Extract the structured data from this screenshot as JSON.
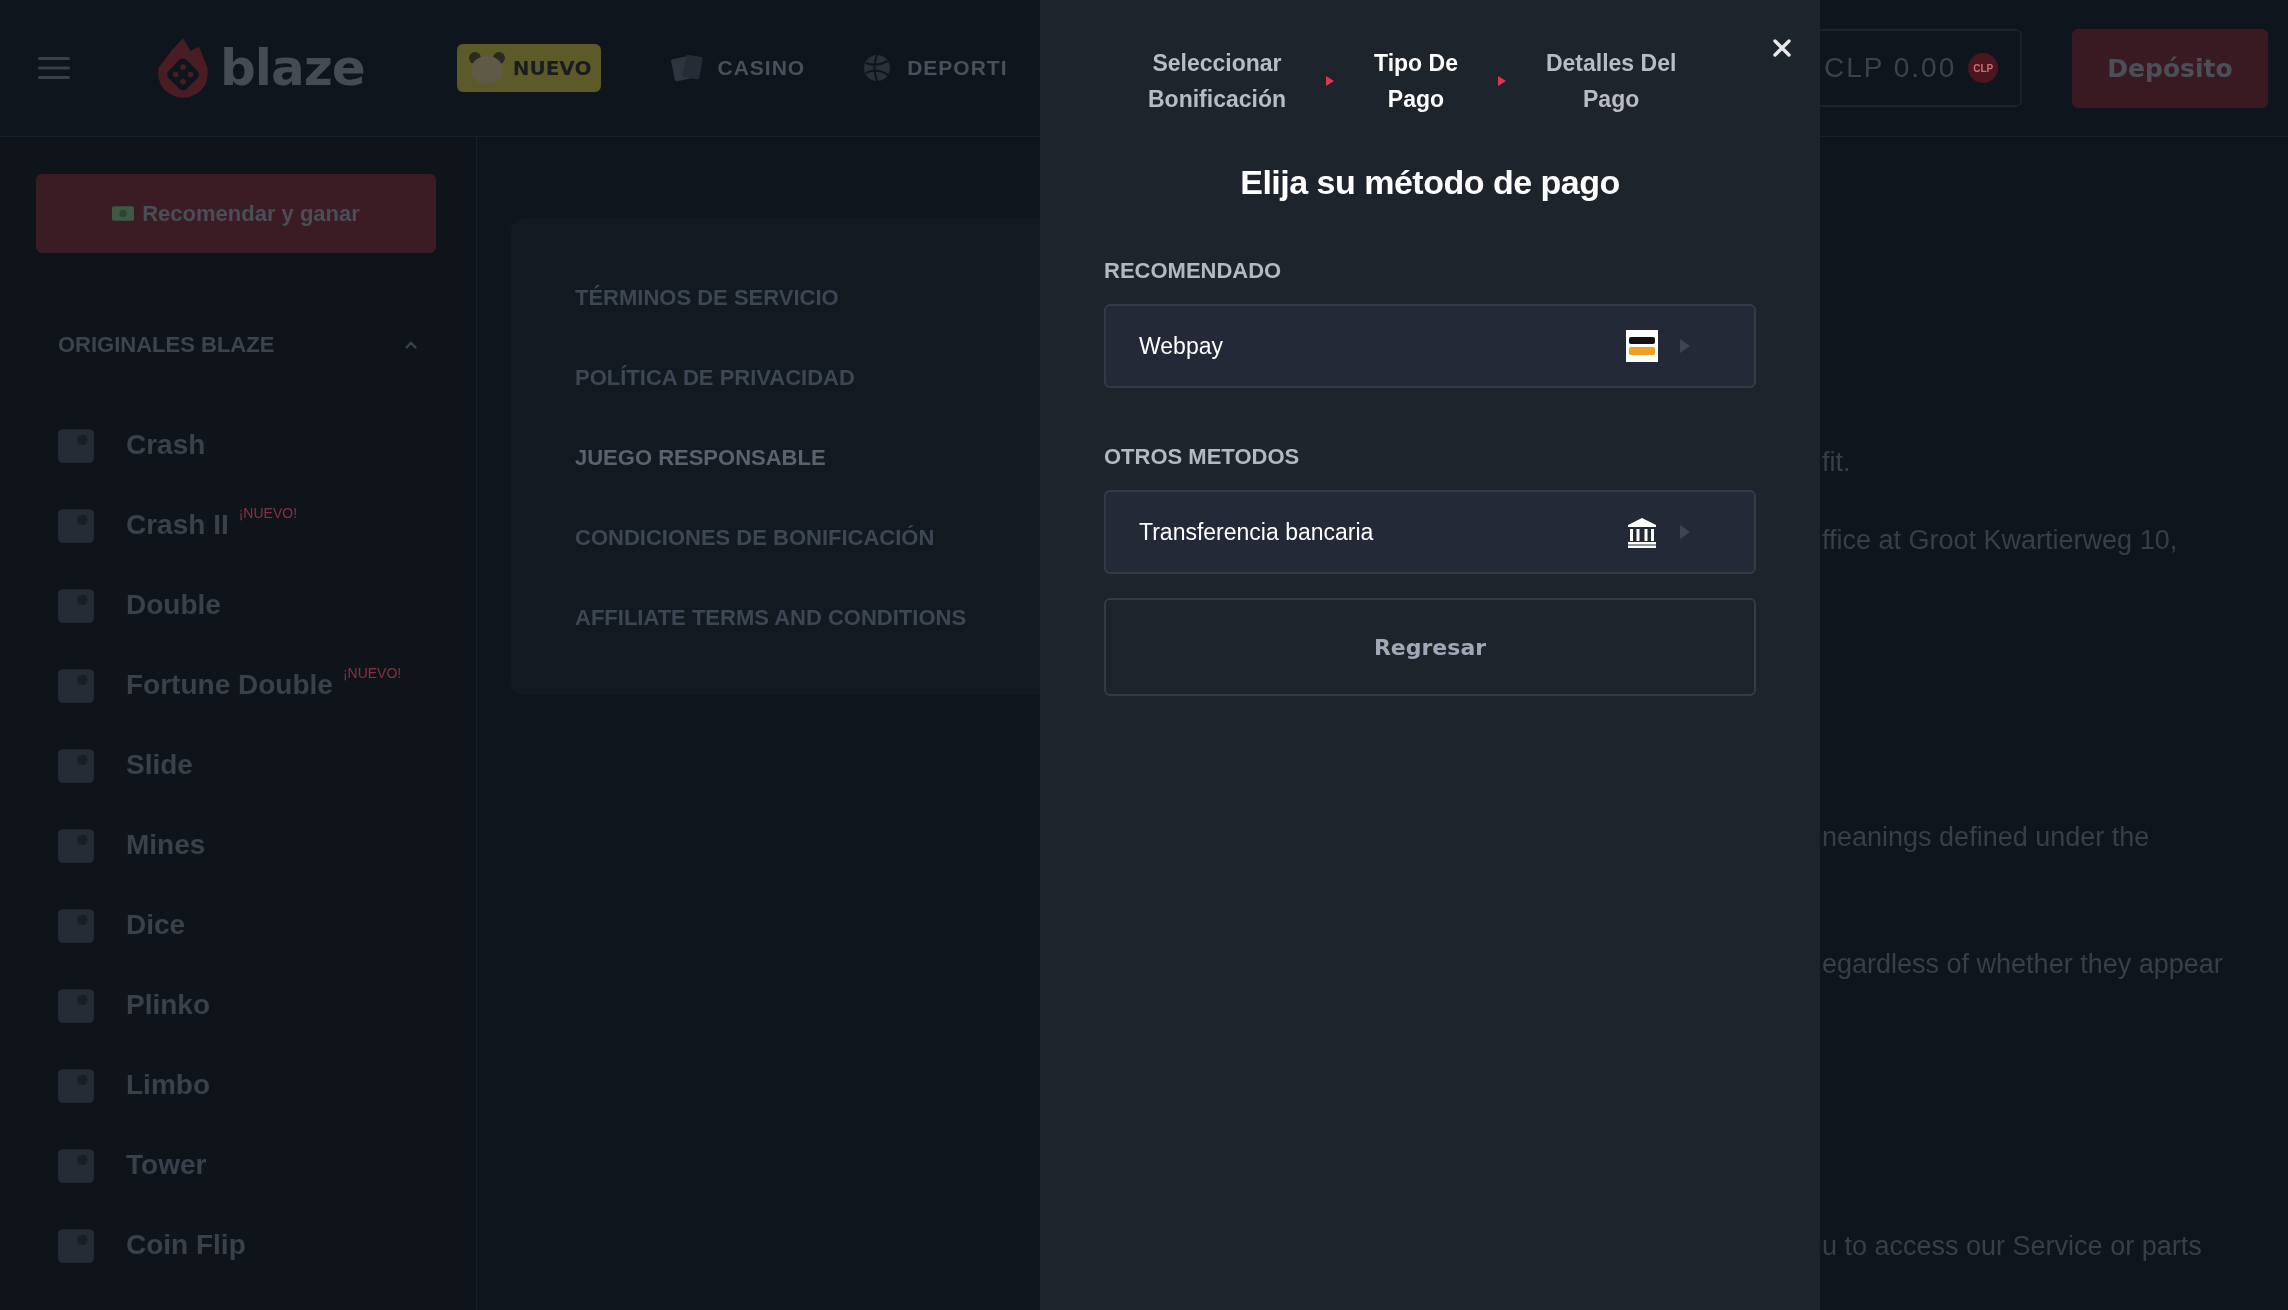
{
  "header": {
    "logo_text": "blaze",
    "promo_badge": "NUEVO",
    "nav": [
      {
        "label": "CASINO"
      },
      {
        "label": "DEPORTI"
      }
    ],
    "balance": "CLP 0.00",
    "currency_badge": "CLP",
    "deposit_button": "Depósito"
  },
  "sidebar": {
    "refer_button": "Recomendar y ganar",
    "section": {
      "title": "ORIGINALES BLAZE",
      "expanded": true
    },
    "items": [
      {
        "label": "Crash"
      },
      {
        "label": "Crash II",
        "badge": "¡NUEVO!"
      },
      {
        "label": "Double"
      },
      {
        "label": "Fortune Double",
        "badge": "¡NUEVO!"
      },
      {
        "label": "Slide"
      },
      {
        "label": "Mines"
      },
      {
        "label": "Dice"
      },
      {
        "label": "Plinko"
      },
      {
        "label": "Limbo"
      },
      {
        "label": "Tower"
      },
      {
        "label": "Coin Flip"
      }
    ]
  },
  "legal_links": [
    {
      "label": "TÉRMINOS DE SERVICIO",
      "selected": false
    },
    {
      "label": "POLÍTICA DE PRIVACIDAD",
      "selected": false
    },
    {
      "label": "JUEGO RESPONSABLE",
      "selected": true
    },
    {
      "label": "CONDICIONES DE BONIFICACIÓN",
      "selected": false
    },
    {
      "label": "AFFILIATE TERMS AND CONDITIONS",
      "selected": false
    }
  ],
  "content_lines": [
    "fit.",
    "ffice at Groot Kwartierweg 10,",
    "neanings defined under the",
    "egardless of whether they appear",
    "u to access our Service or parts"
  ],
  "modal": {
    "steps": [
      {
        "label": "Seleccionar\nBonificación",
        "selected": false
      },
      {
        "label": "Tipo De\nPago",
        "selected": true
      },
      {
        "label": "Detalles Del\nPago",
        "selected": false
      }
    ],
    "title": "Elija su método de pago",
    "sections": [
      {
        "title": "RECOMENDADO",
        "methods": [
          {
            "name": "Webpay",
            "kind": "webpay"
          }
        ]
      },
      {
        "title": "OTROS METODOS",
        "methods": [
          {
            "name": "Transferencia bancaria",
            "kind": "bank"
          }
        ]
      }
    ],
    "back_button": "Regresar"
  }
}
